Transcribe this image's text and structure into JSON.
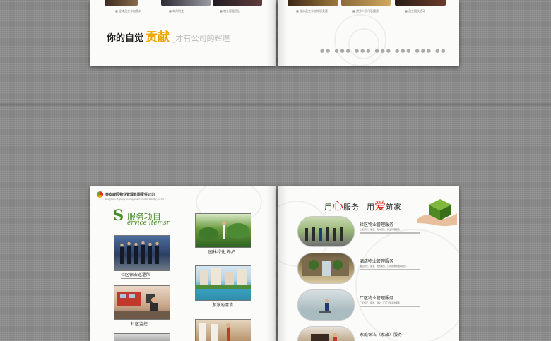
{
  "top_spread": {
    "left_captions": [
      "全体员工参加季训",
      "每月例会",
      "物业客服团队"
    ],
    "right_captions": [
      "全体员工参加知识竞赛",
      "优秀人员代表颁奖",
      "员工团队活动"
    ],
    "slogan": {
      "part1": "你的自觉",
      "highlight": "贡献",
      "part2": "_才有公司的辉煌"
    }
  },
  "bottom_spread": {
    "company_name": "泰安康园物业管理有限责任公司",
    "company_name_en": "KangYuan Property management limited liability co.,ltd",
    "services": {
      "initial": "S",
      "title": "服务项目",
      "subtitle": "ervice itemsr"
    },
    "photos": [
      {
        "name": "security",
        "caption": "社区保安巡逻队"
      },
      {
        "name": "garden",
        "caption": "园林绿化,养护"
      },
      {
        "name": "monitor",
        "caption": "社区监控"
      },
      {
        "name": "pool",
        "caption": "游泳池清洁"
      }
    ],
    "headline": {
      "p1": "用",
      "h1": "心",
      "p2": "服务　用",
      "h2": "爱",
      "p3": "筑家"
    },
    "service_rows": [
      {
        "title": "社区物业管理服务",
        "desc": "社区保安、保洁、园林绿化、物业管理服务"
      },
      {
        "title": "酒店物业管理服务",
        "desc": "酒店保安、保洁、洗衣服务、公共区域清洁等服务"
      },
      {
        "title": "厂区物业管理服务",
        "desc": "厂区保安、保洁、绿化、厂区卫生清洁服务"
      },
      {
        "title": "家庭保洁（家政）服务",
        "desc": ""
      }
    ]
  }
}
